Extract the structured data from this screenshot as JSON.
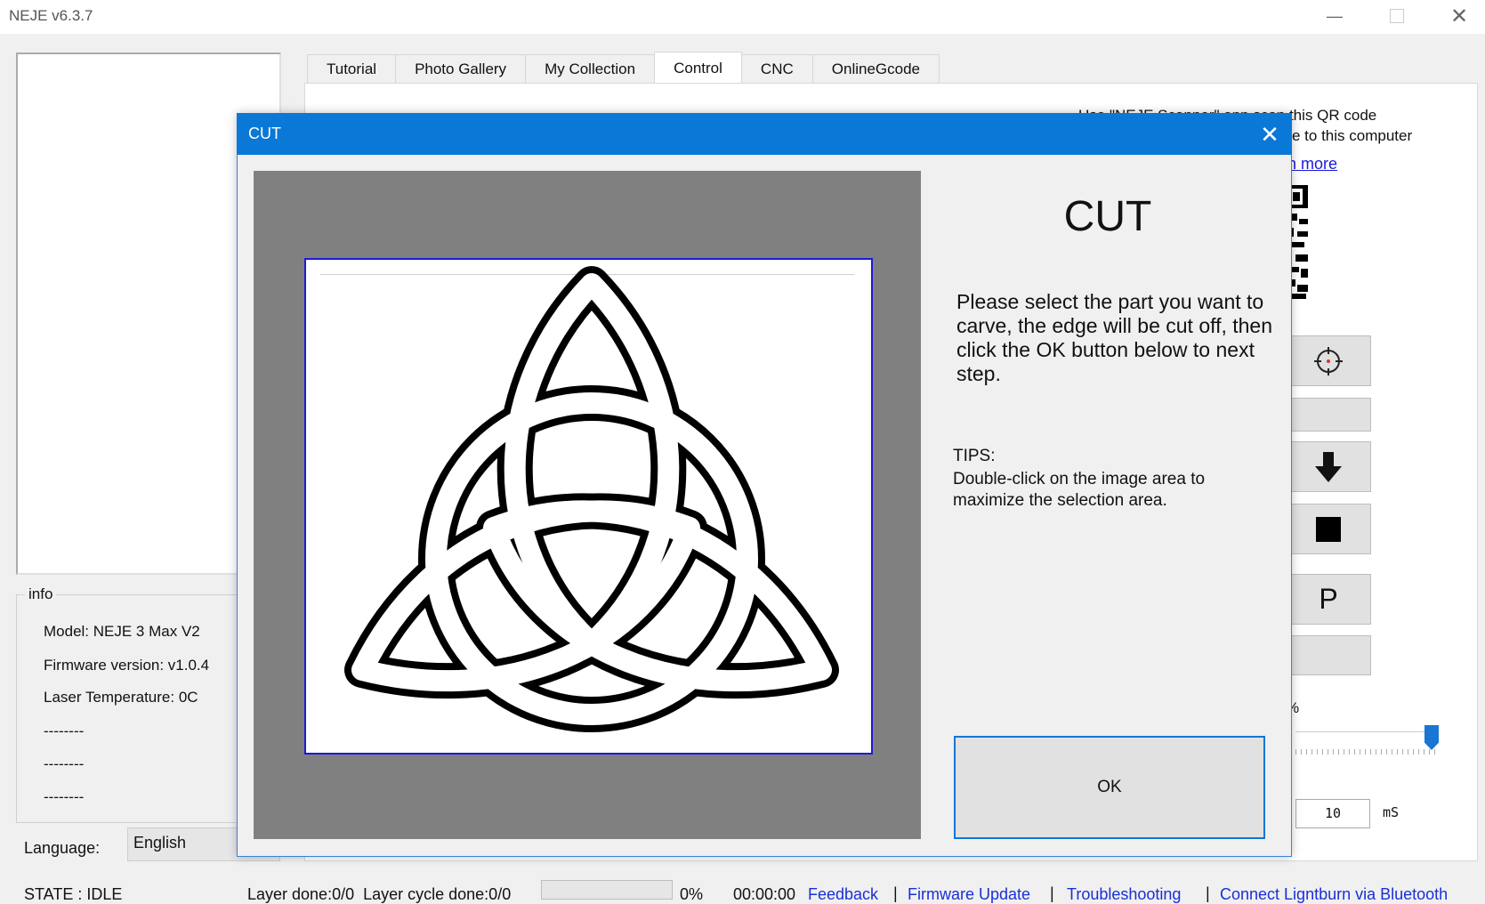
{
  "window": {
    "title": "NEJE v6.3.7",
    "minimize_icon": "minimize-icon",
    "maximize_icon": "maximize-icon",
    "close_icon": "close-icon"
  },
  "info": {
    "legend": "info",
    "model": "Model: NEJE 3 Max V2",
    "firmware": "Firmware version: v1.0.4",
    "temperature": "Laser Temperature: 0C",
    "line4": "--------",
    "line5": "--------",
    "line6": "--------"
  },
  "language": {
    "label": "Language:",
    "value": "English"
  },
  "tabs": [
    {
      "label": "Tutorial",
      "active": false
    },
    {
      "label": "Photo Gallery",
      "active": false
    },
    {
      "label": "My Collection",
      "active": false
    },
    {
      "label": "Control",
      "active": true
    },
    {
      "label": "CNC",
      "active": false
    },
    {
      "label": "OnlineGcode",
      "active": false
    }
  ],
  "control_panel": {
    "qr_text_line1": "Use \"NEJE Scanner\" app scan this QR code",
    "qr_text_line2": "e to this computer",
    "learn_more": "arn more",
    "button_icons": [
      "crosshair-icon",
      "blank",
      "arrow-down-icon",
      "stop-square-icon",
      "p-letter",
      "blank"
    ],
    "p_label": "P",
    "percent_label": "%",
    "slider_level_fraction": 0.97,
    "ms_value": "10",
    "ms_unit": "mS"
  },
  "status": {
    "state": "STATE : IDLE",
    "layer": "Layer done:0/0  Layer cycle done:0/0",
    "progress_fraction": 0,
    "percent": "0%",
    "time": "00:00:00",
    "links": [
      "Feedback",
      "Firmware Update",
      "Troubleshooting",
      "Connect Ligntburn via Bluetooth"
    ],
    "separator": "|"
  },
  "dialog": {
    "title": "CUT",
    "close_icon": "close-icon",
    "heading": "CUT",
    "instructions": "Please select the part you want to carve, the edge will be cut off, then click the OK button below to next step.",
    "tips_label": "TIPS:",
    "tips_text": "Double-click on the image area to maximize the selection area.",
    "ok_label": "OK",
    "image_subject": "triquetra-knot-image"
  }
}
